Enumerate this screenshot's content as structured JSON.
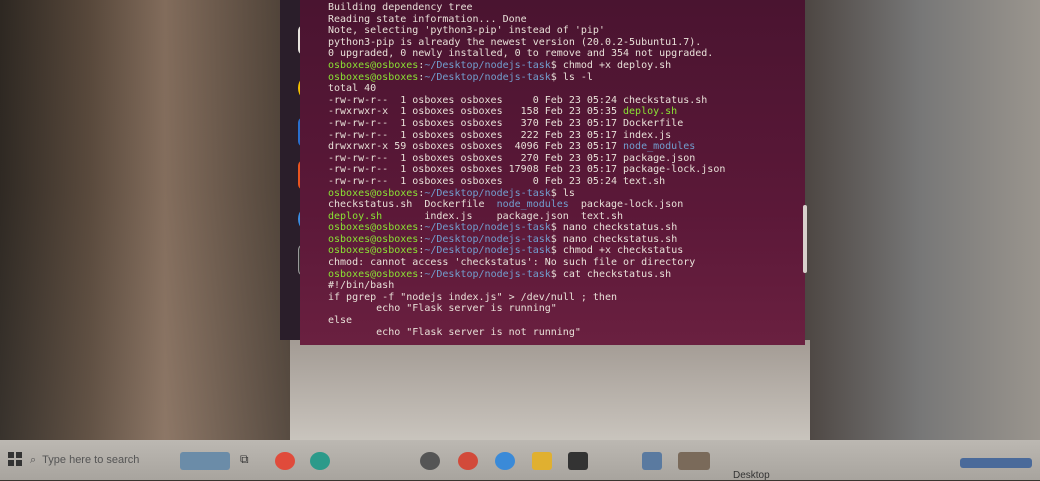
{
  "terminal": {
    "lines": [
      {
        "segments": [
          {
            "t": "Building dependency tree",
            "c": "plain"
          }
        ]
      },
      {
        "segments": [
          {
            "t": "Reading state information... Done",
            "c": "plain"
          }
        ]
      },
      {
        "segments": [
          {
            "t": "Note, selecting 'python3-pip' instead of 'pip'",
            "c": "plain"
          }
        ]
      },
      {
        "segments": [
          {
            "t": "python3-pip is already the newest version (20.0.2-5ubuntu1.7).",
            "c": "plain"
          }
        ]
      },
      {
        "segments": [
          {
            "t": "0 upgraded, 0 newly installed, 0 to remove and 354 not upgraded.",
            "c": "plain"
          }
        ]
      },
      {
        "segments": [
          {
            "t": "osboxes@osboxes",
            "c": "user"
          },
          {
            "t": ":",
            "c": "plain"
          },
          {
            "t": "~/Desktop/nodejs-task",
            "c": "path"
          },
          {
            "t": "$ chmod +x deploy.sh",
            "c": "plain"
          }
        ]
      },
      {
        "segments": [
          {
            "t": "osboxes@osboxes",
            "c": "user"
          },
          {
            "t": ":",
            "c": "plain"
          },
          {
            "t": "~/Desktop/nodejs-task",
            "c": "path"
          },
          {
            "t": "$ ls -l",
            "c": "plain"
          }
        ]
      },
      {
        "segments": [
          {
            "t": "total 40",
            "c": "plain"
          }
        ]
      },
      {
        "segments": [
          {
            "t": "-rw-rw-r--  1 osboxes osboxes     0 Feb 23 05:24 checkstatus.sh",
            "c": "plain"
          }
        ]
      },
      {
        "segments": [
          {
            "t": "-rwxrwxr-x  1 osboxes osboxes   158 Feb 23 05:35 ",
            "c": "plain"
          },
          {
            "t": "deploy.sh",
            "c": "exe"
          }
        ]
      },
      {
        "segments": [
          {
            "t": "-rw-rw-r--  1 osboxes osboxes   370 Feb 23 05:17 Dockerfile",
            "c": "plain"
          }
        ]
      },
      {
        "segments": [
          {
            "t": "-rw-rw-r--  1 osboxes osboxes   222 Feb 23 05:17 index.js",
            "c": "plain"
          }
        ]
      },
      {
        "segments": [
          {
            "t": "drwxrwxr-x 59 osboxes osboxes  4096 Feb 23 05:17 ",
            "c": "plain"
          },
          {
            "t": "node_modules",
            "c": "dir"
          }
        ]
      },
      {
        "segments": [
          {
            "t": "-rw-rw-r--  1 osboxes osboxes   270 Feb 23 05:17 package.json",
            "c": "plain"
          }
        ]
      },
      {
        "segments": [
          {
            "t": "-rw-rw-r--  1 osboxes osboxes 17908 Feb 23 05:17 package-lock.json",
            "c": "plain"
          }
        ]
      },
      {
        "segments": [
          {
            "t": "-rw-rw-r--  1 osboxes osboxes     0 Feb 23 05:24 text.sh",
            "c": "plain"
          }
        ]
      },
      {
        "segments": [
          {
            "t": "osboxes@osboxes",
            "c": "user"
          },
          {
            "t": ":",
            "c": "plain"
          },
          {
            "t": "~/Desktop/nodejs-task",
            "c": "path"
          },
          {
            "t": "$ ls",
            "c": "plain"
          }
        ]
      },
      {
        "segments": [
          {
            "t": "checkstatus.sh  Dockerfile  ",
            "c": "plain"
          },
          {
            "t": "node_modules",
            "c": "dir"
          },
          {
            "t": "  package-lock.json",
            "c": "plain"
          }
        ]
      },
      {
        "segments": [
          {
            "t": "deploy.sh",
            "c": "exe"
          },
          {
            "t": "       index.js    package.json  text.sh",
            "c": "plain"
          }
        ]
      },
      {
        "segments": [
          {
            "t": "osboxes@osboxes",
            "c": "user"
          },
          {
            "t": ":",
            "c": "plain"
          },
          {
            "t": "~/Desktop/nodejs-task",
            "c": "path"
          },
          {
            "t": "$ nano checkstatus.sh",
            "c": "plain"
          }
        ]
      },
      {
        "segments": [
          {
            "t": "osboxes@osboxes",
            "c": "user"
          },
          {
            "t": ":",
            "c": "plain"
          },
          {
            "t": "~/Desktop/nodejs-task",
            "c": "path"
          },
          {
            "t": "$ nano checkstatus.sh",
            "c": "plain"
          }
        ]
      },
      {
        "segments": [
          {
            "t": "osboxes@osboxes",
            "c": "user"
          },
          {
            "t": ":",
            "c": "plain"
          },
          {
            "t": "~/Desktop/nodejs-task",
            "c": "path"
          },
          {
            "t": "$ chmod +x checkstatus",
            "c": "plain"
          }
        ]
      },
      {
        "segments": [
          {
            "t": "chmod: cannot access 'checkstatus': No such file or directory",
            "c": "plain"
          }
        ]
      },
      {
        "segments": [
          {
            "t": "osboxes@osboxes",
            "c": "user"
          },
          {
            "t": ":",
            "c": "plain"
          },
          {
            "t": "~/Desktop/nodejs-task",
            "c": "path"
          },
          {
            "t": "$ cat checkstatus.sh",
            "c": "plain"
          }
        ]
      },
      {
        "segments": [
          {
            "t": "#!/bin/bash",
            "c": "plain"
          }
        ]
      },
      {
        "segments": [
          {
            "t": "if pgrep -f \"nodejs index.js\" > /dev/null ; then",
            "c": "plain"
          }
        ]
      },
      {
        "segments": [
          {
            "t": "        echo \"Flask server is running\"",
            "c": "plain"
          }
        ]
      },
      {
        "segments": [
          {
            "t": "else",
            "c": "plain"
          }
        ]
      },
      {
        "segments": [
          {
            "t": "        echo \"Flask server is not running\"",
            "c": "plain"
          }
        ]
      }
    ]
  },
  "dock": {
    "icons": [
      "files-icon",
      "rhythmbox-icon",
      "libreoffice-writer-icon",
      "software-center-icon",
      "help-icon",
      "terminal-icon",
      "show-apps-icon"
    ]
  },
  "taskbar": {
    "search_placeholder": "Type here to search",
    "desktop_label": "Desktop"
  },
  "colors": {
    "terminal_bg": "#5b1838",
    "user": "#8ae234",
    "path": "#729fcf"
  }
}
